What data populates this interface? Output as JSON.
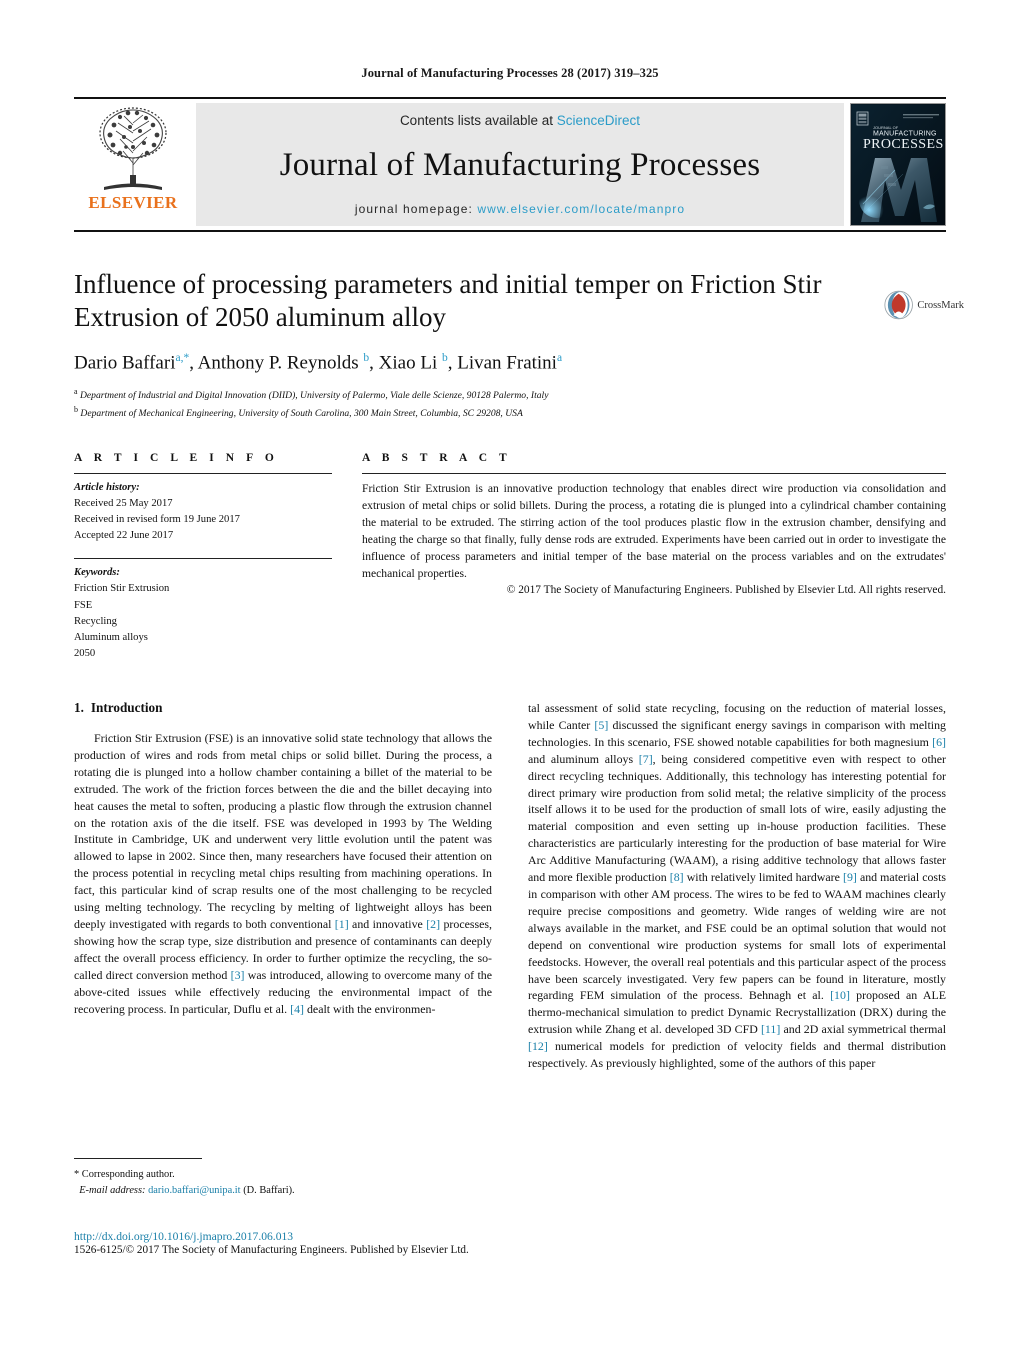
{
  "running_head": "Journal of Manufacturing Processes 28 (2017) 319–325",
  "masthead": {
    "publisher_name": "ELSEVIER",
    "contents_prefix": "Contents lists available at ",
    "contents_link": "ScienceDirect",
    "journal_title": "Journal of Manufacturing Processes",
    "homepage_prefix": "journal homepage: ",
    "homepage_url": "www.elsevier.com/locate/manpro",
    "cover_line1": "JOURNAL OF",
    "cover_line2": "MANUFACTURING",
    "cover_line3": "PROCESSES",
    "accent_link_color": "#2b9cc8",
    "elsevier_orange": "#E9711C"
  },
  "article": {
    "title": "Influence of processing parameters and initial temper on Friction Stir Extrusion of 2050 aluminum alloy",
    "authors_html": "Dario Baffari<sup>a,*</sup>, Anthony P. Reynolds <sup>b</sup>, Xiao Li <sup>b</sup>, Livan Fratini<sup>a</sup>",
    "affiliations": [
      "a Department of Industrial and Digital Innovation (DIID), University of Palermo, Viale delle Scienze, 90128 Palermo, Italy",
      "b Department of Mechanical Engineering, University of South Carolina, 300 Main Street, Columbia, SC 29208, USA"
    ],
    "crossmark_label": "CrossMark"
  },
  "article_info": {
    "heading": "A R T I C L E   I N F O",
    "history_label": "Article history:",
    "history": [
      "Received 25 May 2017",
      "Received in revised form 19 June 2017",
      "Accepted 22 June 2017"
    ],
    "keywords_label": "Keywords:",
    "keywords": [
      "Friction Stir Extrusion",
      "FSE",
      "Recycling",
      "Aluminum alloys",
      "2050"
    ]
  },
  "abstract": {
    "heading": "A B S T R A C T",
    "text": "Friction Stir Extrusion is an innovative production technology that enables direct wire production via consolidation and extrusion of metal chips or solid billets. During the process, a rotating die is plunged into a cylindrical chamber containing the material to be extruded. The stirring action of the tool produces plastic flow in the extrusion chamber, densifying and heating the charge so that finally, fully dense rods are extruded. Experiments have been carried out in order to investigate the influence of process parameters and initial temper of the base material on the process variables and on the extrudates' mechanical properties.",
    "copyright": "© 2017 The Society of Manufacturing Engineers. Published by Elsevier Ltd. All rights reserved."
  },
  "body": {
    "section_number": "1.",
    "section_title": "Introduction",
    "left_paragraph_1": "Friction Stir Extrusion (FSE) is an innovative solid state technology that allows the production of wires and rods from metal chips or solid billet. During the process, a rotating die is plunged into a hollow chamber containing a billet of the material to be extruded. The work of the friction forces between the die and the billet decaying into heat causes the metal to soften, producing a plastic flow through the extrusion channel on the rotation axis of the die itself. FSE was developed in 1993 by The Welding Institute in Cambridge, UK and underwent very little evolution until the patent was allowed to lapse in 2002. Since then, many researchers have focused their attention on the process potential in recycling metal chips resulting from machining operations. In fact, this particular kind of scrap results one of the most challenging to be recycled using melting technology. The recycling by melting of lightweight alloys has been deeply investigated with regards to both conventional [1] and innovative [2] processes, showing how the scrap type, size distribution and presence of contaminants can deeply affect the overall process efficiency. In order to further optimize the recycling, the so-called direct conversion method [3] was introduced, allowing to overcome many of the above-cited issues while effectively reducing the environmental impact of the recovering process. In particular, Duflu et al. [4] dealt with the environmen-",
    "right_paragraph_1": "tal assessment of solid state recycling, focusing on the reduction of material losses, while Canter [5] discussed the significant energy savings in comparison with melting technologies. In this scenario, FSE showed notable capabilities for both magnesium [6] and aluminum alloys [7], being considered competitive even with respect to other direct recycling techniques. Additionally, this technology has interesting potential for direct primary wire production from solid metal; the relative simplicity of the process itself allows it to be used for the production of small lots of wire, easily adjusting the material composition and even setting up in-house production facilities. These characteristics are particularly interesting for the production of base material for Wire Arc Additive Manufacturing (WAAM), a rising additive technology that allows faster and more flexible production [8] with relatively limited hardware [9] and material costs in comparison with other AM process. The wires to be fed to WAAM machines clearly require precise compositions and geometry. Wide ranges of welding wire are not always available in the market, and FSE could be an optimal solution that would not depend on conventional wire production systems for small lots of experimental feedstocks. However, the overall real potentials and this particular aspect of the process have been scarcely investigated. Very few papers can be found in literature, mostly regarding FEM simulation of the process. Behnagh et al. [10] proposed an ALE thermo-mechanical simulation to predict Dynamic Recrystallization (DRX) during the extrusion while Zhang et al. developed 3D CFD [11] and 2D axial symmetrical thermal [12] numerical models for prediction of velocity fields and thermal distribution respectively. As previously highlighted, some of the authors of this paper",
    "reference_color": "#1a7fa8"
  },
  "footnote": {
    "corresponding": "* Corresponding author.",
    "email_label": "E-mail address:",
    "email": "dario.baffari@unipa.it",
    "email_suffix": "(D. Baffari)."
  },
  "footer": {
    "doi": "http://dx.doi.org/10.1016/j.jmapro.2017.06.013",
    "issn_line": "1526-6125/© 2017 The Society of Manufacturing Engineers. Published by Elsevier Ltd."
  }
}
